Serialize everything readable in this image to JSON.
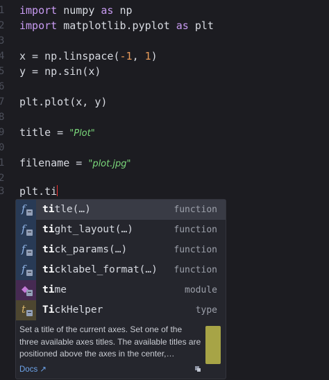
{
  "editor": {
    "line_numbers": [
      "1",
      "2",
      "3",
      "4",
      "5",
      "6",
      "7",
      "8",
      "9",
      "0",
      "1",
      "2",
      "3"
    ],
    "lines": [
      {
        "kw1": "import",
        "text1": " numpy ",
        "kw2": "as",
        "text2": " np"
      },
      {
        "kw1": "import",
        "text1": " matplotlib.pyplot ",
        "kw2": "as",
        "text2": " plt"
      },
      {},
      {
        "text1": "x = np.linspace(",
        "num1": "-1",
        "text2": ", ",
        "num2": "1",
        "text3": ")"
      },
      {
        "text1": "y = np.sin(x)"
      },
      {},
      {
        "text1": "plt.plot(x, y)"
      },
      {},
      {
        "text1": "title = ",
        "str": "\"Plot\""
      },
      {},
      {
        "text1": "filename = ",
        "str": "\"plot.jpg\""
      },
      {},
      {
        "text1": "plt.ti"
      }
    ]
  },
  "autocomplete": {
    "items": [
      {
        "icon": "function-icon",
        "glyph": "f",
        "match": "ti",
        "rest": "tle(…)",
        "type": "function",
        "selected": true
      },
      {
        "icon": "function-icon",
        "glyph": "f",
        "match": "ti",
        "rest": "ght_layout(…)",
        "type": "function"
      },
      {
        "icon": "function-icon",
        "glyph": "f",
        "match": "ti",
        "rest": "ck_params(…)",
        "type": "function"
      },
      {
        "icon": "function-icon",
        "glyph": "f",
        "match": "ti",
        "rest": "cklabel_format(…)",
        "type": "function"
      },
      {
        "icon": "module-icon",
        "glyph": "◆",
        "match": "ti",
        "rest": "me",
        "type": "module"
      },
      {
        "icon": "type-icon",
        "glyph": "t",
        "match": "Ti",
        "rest": "ckHelper",
        "type": "type"
      }
    ],
    "doc": {
      "text": "Set a title of the current axes. Set one of the three available axes titles. The available titles are positioned above the axes in the center,…",
      "link_label": "Docs ↗"
    }
  },
  "colors": {
    "background": "#1c1c21",
    "keyword": "#c89bf2",
    "number": "#e79a5a",
    "string": "#7bd97b",
    "cursor": "#ee3333",
    "doc_bar": "#a7a446"
  }
}
